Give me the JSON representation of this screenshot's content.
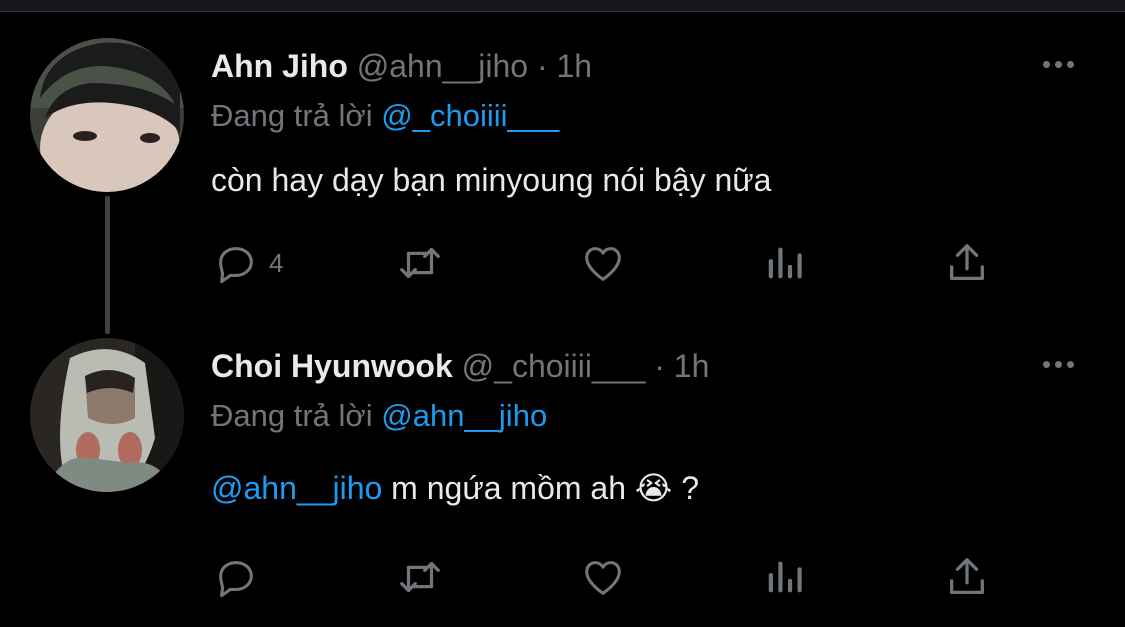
{
  "colors": {
    "background": "#000000",
    "text": "#e7e9ea",
    "muted": "#71767b",
    "accent": "#1d9bf0"
  },
  "tweets": [
    {
      "name": "Ahn Jiho",
      "handle": "@ahn__jiho",
      "separator": "·",
      "time": "1h",
      "reply_prefix": "Đang trả lời",
      "reply_to": "@_choiiii___",
      "text": "còn hay dạy bạn minyoung nói bậy nữa",
      "reply_count": "4"
    },
    {
      "name": "Choi Hyunwook",
      "handle": "@_choiiii___",
      "separator": "·",
      "time": "1h",
      "reply_prefix": "Đang trả lời",
      "reply_to": "@ahn__jiho",
      "text_mention": "@ahn__jiho",
      "text": " m ngứa mồm ah ",
      "emoji": "😭",
      "text_end": " ?",
      "reply_count": ""
    }
  ],
  "icons": {
    "reply": "reply-icon",
    "retweet": "retweet-icon",
    "like": "heart-icon",
    "views": "views-icon",
    "share": "share-icon",
    "more": "more-icon"
  }
}
